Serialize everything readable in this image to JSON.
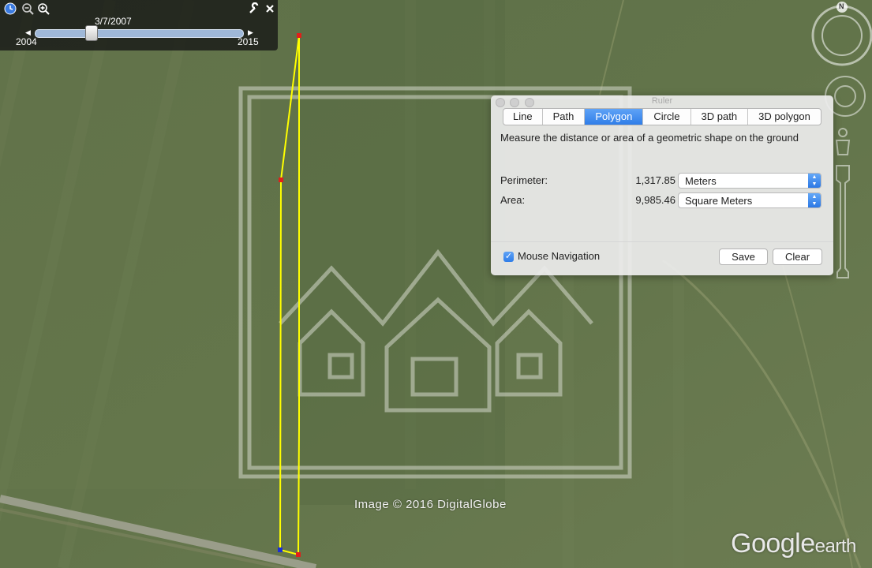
{
  "time_slider": {
    "date": "3/7/2007",
    "start_year": "2004",
    "end_year": "2015",
    "position_fraction": 0.27
  },
  "ruler": {
    "title": "Ruler",
    "tabs": [
      "Line",
      "Path",
      "Polygon",
      "Circle",
      "3D path",
      "3D polygon"
    ],
    "active_tab": "Polygon",
    "description": "Measure the distance or area of a geometric shape on the ground",
    "perimeter": {
      "label": "Perimeter:",
      "value": "1,317.85",
      "unit": "Meters"
    },
    "area": {
      "label": "Area:",
      "value": "9,985.46",
      "unit": "Square Meters"
    },
    "mouse_navigation": {
      "label": "Mouse Navigation",
      "checked": true
    },
    "save_label": "Save",
    "clear_label": "Clear"
  },
  "map": {
    "credit": "Image © 2016 DigitalGlobe",
    "logo_main": "Google",
    "logo_sub": "earth",
    "compass_label": "N",
    "polygon_color": "#ffff00",
    "vertex_color": "#e0201a"
  }
}
